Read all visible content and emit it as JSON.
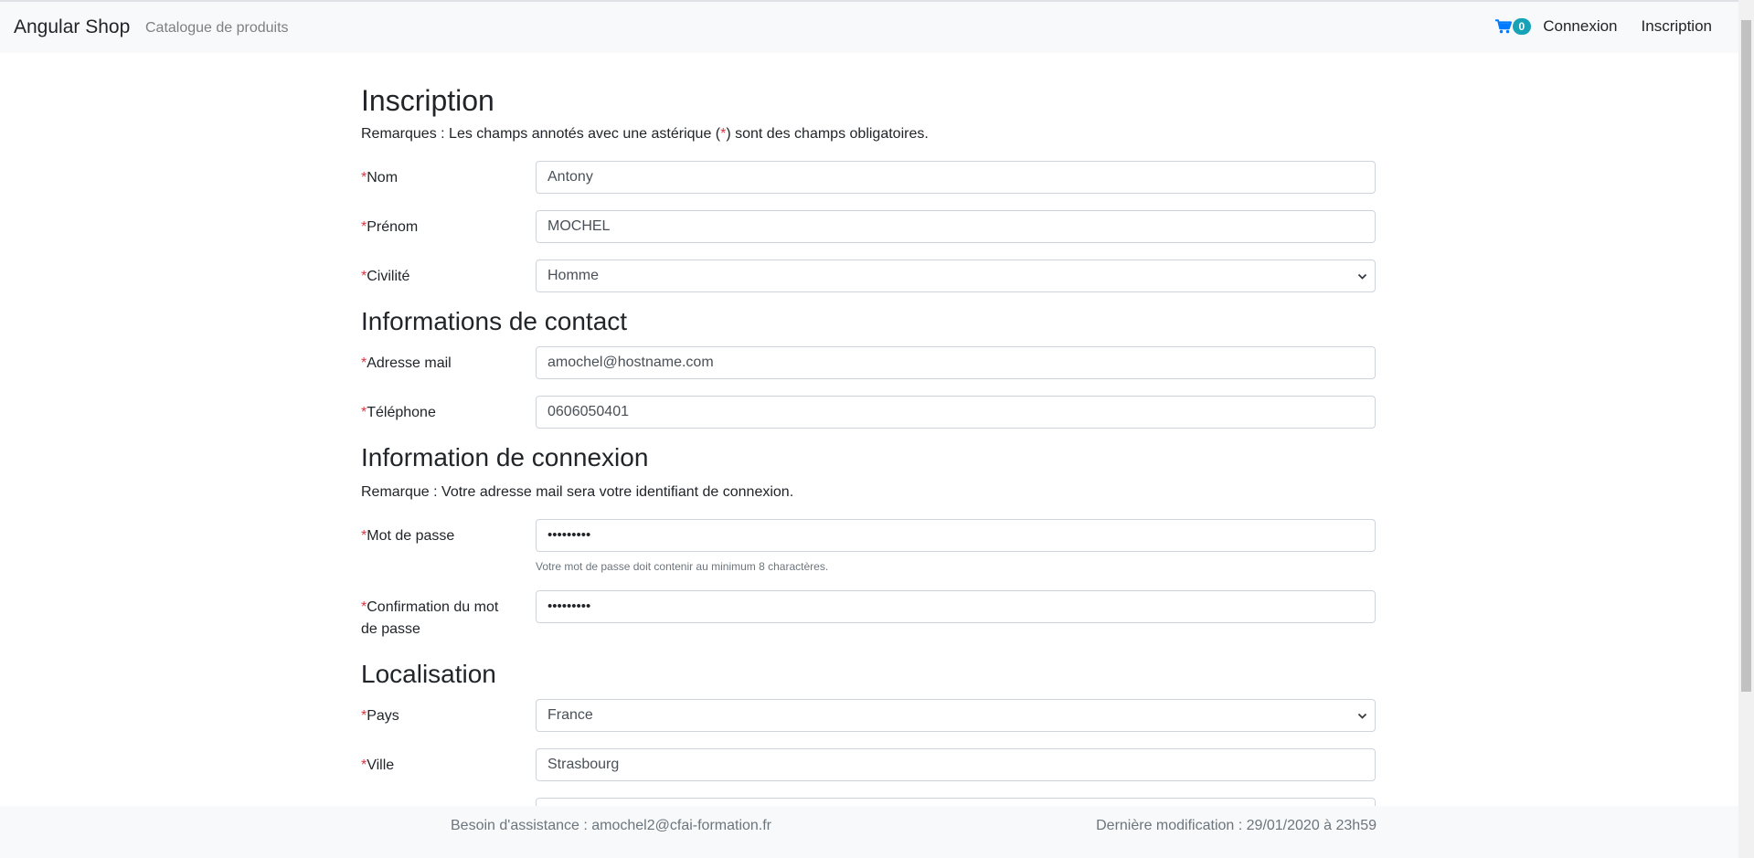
{
  "navbar": {
    "brand": "Angular Shop",
    "catalogue": "Catalogue de produits",
    "cart_count": "0",
    "login": "Connexion",
    "register": "Inscription"
  },
  "form": {
    "title": "Inscription",
    "note_prefix": "Remarques : Les champs annotés avec une astérique (",
    "note_star": "*",
    "note_suffix": ") sont des champs obligatoires.",
    "required_mark": "*",
    "nom": {
      "label": "Nom",
      "value": "Antony"
    },
    "prenom": {
      "label": "Prénom",
      "value": "MOCHEL"
    },
    "civilite": {
      "label": "Civilité",
      "value": "Homme"
    },
    "contact_title": "Informations de contact",
    "email": {
      "label": "Adresse mail",
      "value": "amochel@hostname.com"
    },
    "telephone": {
      "label": "Téléphone",
      "value": "0606050401"
    },
    "connexion_title": "Information de connexion",
    "connexion_note": "Remarque : Votre adresse mail sera votre identifiant de connexion.",
    "password": {
      "label": "Mot de passe",
      "value": "•••••••••",
      "help": "Votre mot de passe doit contenir au minimum 8 charactères."
    },
    "password_confirm": {
      "label_line1": "Confirmation du mot",
      "label_line2": "de passe",
      "value": "•••••••••"
    },
    "localisation_title": "Localisation",
    "pays": {
      "label": "Pays",
      "value": "France"
    },
    "ville": {
      "label": "Ville",
      "value": "Strasbourg"
    }
  },
  "footer": {
    "assistance": "Besoin d'assistance : amochel2@cfai-formation.fr",
    "last_modified": "Dernière modification : 29/01/2020 à 23h59"
  },
  "colors": {
    "required": "#dc3545",
    "badge": "#17a2b8",
    "cart_icon": "#007bff",
    "navbar_bg": "#f8f9fa"
  }
}
